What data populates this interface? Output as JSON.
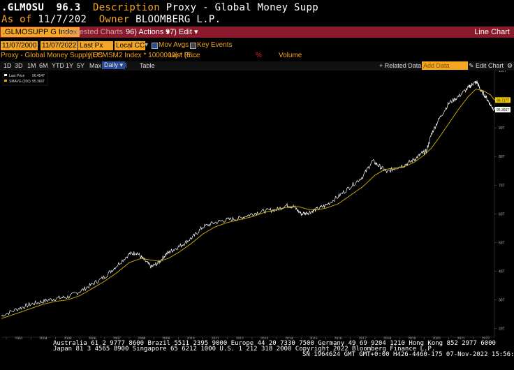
{
  "header": {
    "ticker": ".GLMOSU",
    "price": "96.3",
    "description_label": "Description",
    "description": "Proxy - Global Money Supp",
    "asof_label": "As of",
    "asof": "11/7/202",
    "owner_label": "Owner",
    "owner": "BLOOMBERG L.P."
  },
  "toolbar": {
    "security": ".GLMOSUPP G Index",
    "suggested": "Suggested Charts",
    "actions": "96) Actions",
    "edit": "97) Edit",
    "chart_type": "Line Chart"
  },
  "settings": {
    "start_date": "11/07/2000",
    "end_date": "11/07/2022",
    "field": "Last Px",
    "currency": "Local CCY",
    "mov_avgs": "Mov Avgs",
    "key_events": "Key Events"
  },
  "series_row": {
    "name": "Proxy - Global Money Supply US",
    "formula": "((ECMSM2 Index * 1000000) * (E...",
    "last_price": "Last Price",
    "pct": "%",
    "volume": "Volume"
  },
  "periods": [
    "1D",
    "3D",
    "1M",
    "6M",
    "YTD",
    "1Y",
    "5Y",
    "Max"
  ],
  "frequency": "Daily",
  "table_label": "Table",
  "related_data": "+ Related Data",
  "add_data": "Add Data",
  "edit_chart": "Edit Chart",
  "chart_data": {
    "type": "line",
    "x_range": [
      2002.8,
      2022.86
    ],
    "ylim": [
      17,
      110
    ],
    "y_unit": "T",
    "y_ticks": [
      20,
      30,
      40,
      50,
      60,
      70,
      80,
      90,
      100,
      110
    ],
    "x_ticks": [
      "2003",
      "2004",
      "2005",
      "2006",
      "2007",
      "2008",
      "2009",
      "2010",
      "2011",
      "2012",
      "2013",
      "2014",
      "2015",
      "2016",
      "2017",
      "2018",
      "2019",
      "2020",
      "2021",
      "2022"
    ],
    "legend": {
      "position": "top-left",
      "entries": [
        {
          "label": "Last Price",
          "value": "96.4547",
          "color": "#ffffff"
        },
        {
          "label": "SMAVG (200)",
          "value": "95.366T",
          "color": "#d4b400"
        }
      ]
    },
    "last_value_labels": [
      {
        "text": "99.717T",
        "value": 99.7,
        "color": "#f0d000"
      },
      {
        "text": "96.366T",
        "value": 96.37,
        "color": "#ffffff"
      }
    ],
    "grid": false,
    "series": [
      {
        "name": "Last Price",
        "color": "#ffffff",
        "x": [
          2002.8,
          2003.5,
          2004.0,
          2004.5,
          2005.0,
          2005.5,
          2006.0,
          2006.5,
          2007.0,
          2007.5,
          2008.0,
          2008.3,
          2008.6,
          2008.9,
          2009.2,
          2009.5,
          2009.8,
          2010.2,
          2010.6,
          2011.0,
          2011.5,
          2012.0,
          2012.5,
          2013.0,
          2013.5,
          2014.0,
          2014.4,
          2014.7,
          2015.0,
          2015.3,
          2015.6,
          2016.0,
          2016.5,
          2017.0,
          2017.5,
          2017.9,
          2018.2,
          2018.5,
          2018.8,
          2019.2,
          2019.6,
          2019.9,
          2020.1,
          2020.3,
          2020.6,
          2021.0,
          2021.4,
          2021.8,
          2022.0,
          2022.15,
          2022.3,
          2022.5,
          2022.7,
          2022.86
        ],
        "y": [
          24.5,
          27.0,
          28.5,
          29.5,
          30.5,
          31.0,
          33.0,
          35.5,
          38.0,
          42.0,
          46.0,
          46.5,
          44.0,
          41.5,
          43.0,
          46.0,
          47.5,
          49.5,
          52.0,
          55.5,
          57.0,
          58.0,
          58.5,
          60.0,
          61.0,
          61.5,
          63.0,
          62.5,
          60.0,
          60.5,
          61.5,
          63.0,
          66.0,
          69.5,
          73.0,
          78.5,
          76.5,
          74.5,
          76.0,
          77.0,
          79.0,
          81.0,
          82.0,
          88.0,
          93.0,
          98.5,
          101.0,
          104.0,
          105.5,
          106.0,
          103.0,
          101.0,
          98.0,
          96.4
        ]
      },
      {
        "name": "SMAVG (200)",
        "color": "#d4b400",
        "x": [
          2002.8,
          2003.5,
          2004.0,
          2004.5,
          2005.0,
          2005.5,
          2006.0,
          2006.5,
          2007.0,
          2007.5,
          2008.0,
          2008.5,
          2008.8,
          2009.2,
          2009.6,
          2010.0,
          2010.5,
          2011.0,
          2011.5,
          2012.0,
          2012.5,
          2013.0,
          2013.5,
          2014.0,
          2014.5,
          2014.9,
          2015.3,
          2015.7,
          2016.0,
          2016.5,
          2017.0,
          2017.5,
          2018.0,
          2018.4,
          2018.8,
          2019.2,
          2019.6,
          2020.0,
          2020.3,
          2020.6,
          2021.0,
          2021.4,
          2021.8,
          2022.1,
          2022.4,
          2022.7,
          2022.86
        ],
        "y": [
          23.5,
          25.5,
          27.0,
          28.5,
          29.5,
          30.0,
          31.5,
          34.0,
          36.5,
          39.5,
          43.0,
          44.5,
          44.0,
          43.5,
          44.5,
          46.5,
          49.5,
          53.0,
          55.5,
          57.0,
          58.0,
          59.0,
          60.5,
          61.5,
          62.5,
          62.5,
          61.5,
          61.5,
          62.0,
          63.5,
          66.5,
          69.5,
          73.5,
          75.5,
          76.0,
          76.5,
          78.0,
          80.5,
          83.0,
          86.5,
          91.5,
          96.5,
          101.0,
          103.5,
          103.0,
          101.5,
          99.7
        ]
      }
    ]
  },
  "footer": {
    "line1": "Australia 61 2 9777 8600  Brazil 5511 2395 9000  Europe 44 20 7330 7500  Germany 49 69 9204 1210  Hong Kong 852 2977 6000",
    "line2": "Japan 81 3 4565 8900         Singapore 65 6212 1000        U.S. 1 212 318 2000              Copyright 2022 Bloomberg Finance L.P.",
    "line3": "SN 1964624 GMT  GMT+0:00 H426-4460-175 07-Nov-2022 15:56:56"
  }
}
